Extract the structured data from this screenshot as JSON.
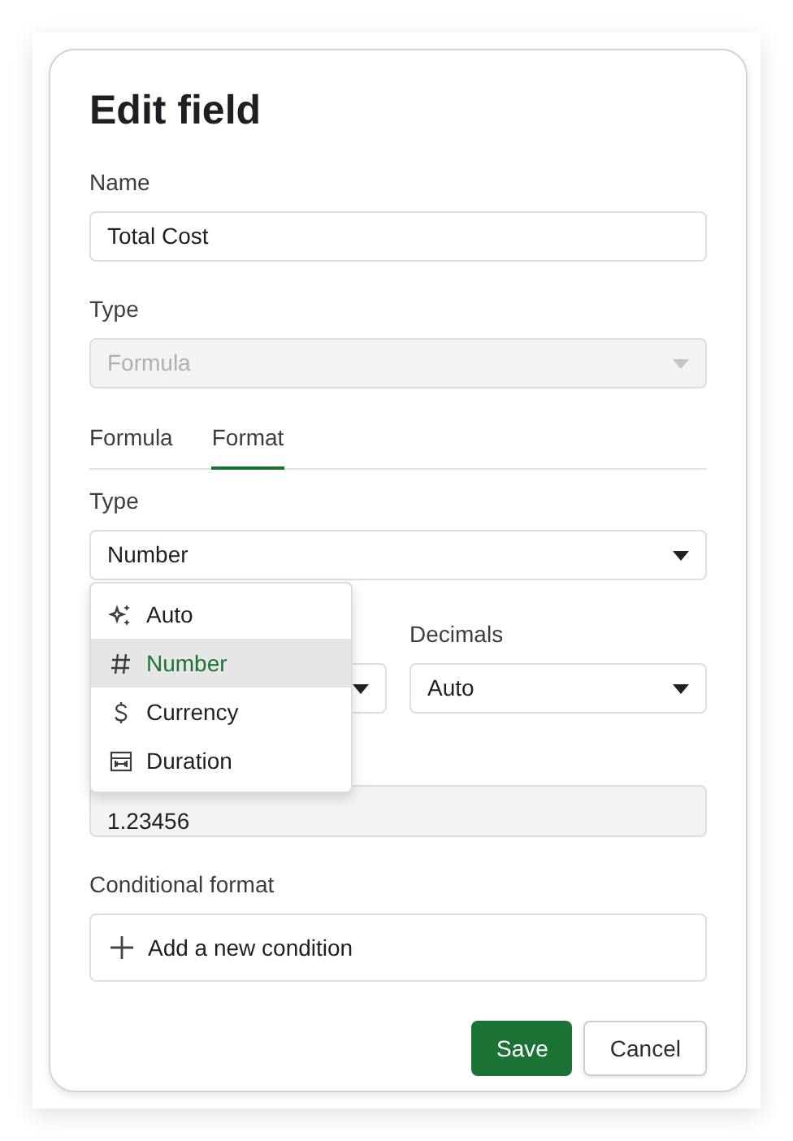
{
  "dialog": {
    "title": "Edit field",
    "name_field": {
      "label": "Name",
      "value": "Total Cost"
    },
    "type_field": {
      "label": "Type",
      "value": "Formula",
      "disabled": true
    },
    "tabs": [
      {
        "label": "Formula",
        "selected": false
      },
      {
        "label": "Format",
        "selected": true
      }
    ],
    "format_type": {
      "label": "Type",
      "value": "Number",
      "expanded": true,
      "options": [
        {
          "label": "Auto",
          "kind": "auto",
          "selected": false
        },
        {
          "label": "Number",
          "kind": "number",
          "selected": true
        },
        {
          "label": "Currency",
          "kind": "currency",
          "selected": false
        },
        {
          "label": "Duration",
          "kind": "duration",
          "selected": false
        }
      ]
    },
    "decimals": {
      "label": "Decimals",
      "value": "Auto"
    },
    "preview": {
      "value": "1.23456"
    },
    "conditional_format": {
      "label": "Conditional format",
      "add_button": "Add a new condition"
    },
    "buttons": [
      {
        "label": "Save",
        "kind": "primary"
      },
      {
        "label": "Cancel",
        "kind": "secondary"
      }
    ]
  }
}
